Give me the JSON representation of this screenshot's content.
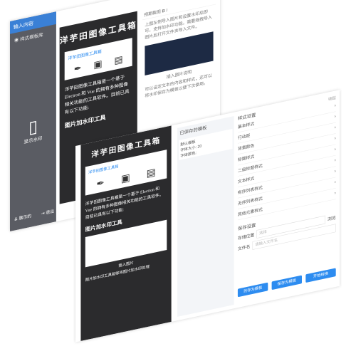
{
  "back": {
    "brand": "输入内容",
    "side_item": "样式模板库",
    "side_doc": "显示水印",
    "side_bottom": [
      "展示的",
      "退出"
    ],
    "title": "洋芋田图像工具箱",
    "card_title": "洋芋田图像工具箱",
    "para": "洋芋田图像工具箱是一个基于 Electron 和 Vue 的拥有多种图像相关功能的工具软件。目前已具有以下功能:",
    "h3": "图片加水印工具",
    "editor_toolbar": "预期截图",
    "editor_text": "上图左侧导入图片和设置水印后即可，支持加水印功能。需要拖拽导入图片后打开文件夹导入文件。",
    "caption": "插入图片说明",
    "editor_text2": "可以设定文本的内容和样式，还可以将水印保存为模板以便下次使用。"
  },
  "front": {
    "title": "洋芋田图像工具箱",
    "card_title": "洋芋田图像工具箱",
    "para": "洋芋田图像工具箱是一个基于 Electron 和 Vue 的拥有多种图像相关功能的工具软件。目前已具有以下功能:",
    "h3": "图片加水印工具",
    "caption": "插入图片",
    "foot": "图片加水印工具能够将图片加水印处理",
    "saved_title": "已保存的模板",
    "saved_item": "默认模板",
    "saved_meta1": "字体大小: 20",
    "saved_meta2": "字体颜色:",
    "style_title": "样式设置",
    "style_collapse": "收起",
    "style_rows": [
      "基本样式",
      "行动距",
      "背景颜色",
      "标题样式",
      "二级标题样式",
      "文本样式",
      "有序列表样式",
      "无序列表样式",
      "其他元素样式"
    ],
    "font_size_value": "20",
    "save_title": "保存设置",
    "save_label1": "存储位置",
    "save_label2": "文件名",
    "save_placeholder1": "选择",
    "save_placeholder2": "请输入文件名",
    "save_btn_small": "浏览",
    "btn1": "另存为模板",
    "btn2": "保存为模板",
    "btn3": "开始转换"
  },
  "colors": {
    "accent": "#2d8cf0",
    "dark": "#2b2b2d",
    "sidebar": "#5a5c63"
  }
}
